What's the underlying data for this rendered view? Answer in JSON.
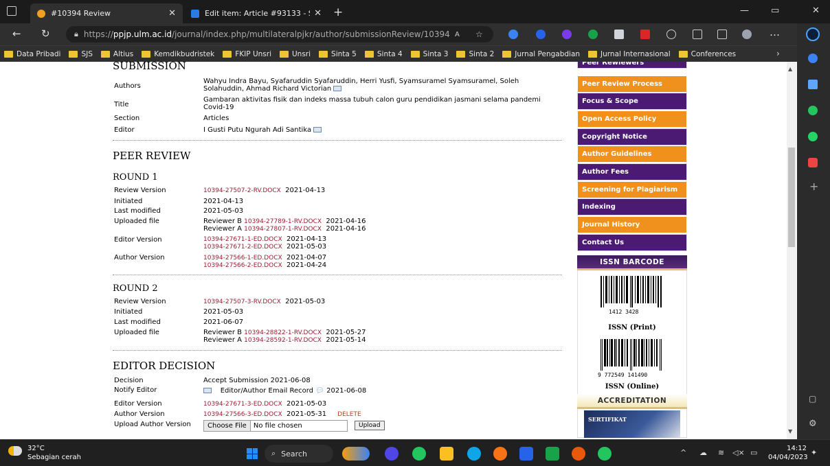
{
  "browser": {
    "tabs": [
      {
        "title": "#10394 Review",
        "active": true
      },
      {
        "title": "Edit item: Article #93133 - Sriwija",
        "active": false
      }
    ],
    "url": {
      "prefix": "https://",
      "host": "ppjp.ulm.ac.id",
      "path": "/journal/index.php/multilateralpjkr/author/submissionReview/10394"
    },
    "bookmarks": [
      "Data Pribadi",
      "SJS",
      "Altius",
      "Kemdikbudristek",
      "FKIP Unsri",
      "Unsri",
      "Sinta 5",
      "Sinta 4",
      "Sinta 3",
      "Sinta 2",
      "Jurnal Pengabdian",
      "Jurnal Internasional",
      "Conferences"
    ]
  },
  "submission": {
    "heading": "SUBMISSION",
    "authors_label": "Authors",
    "authors": "Wahyu Indra Bayu, Syafaruddin Syafaruddin, Herri Yusfi, Syamsuramel Syamsuramel, Soleh Solahuddin, Ahmad Richard Victorian",
    "title_label": "Title",
    "title": "Gambaran aktivitas fisik dan indeks massa tubuh calon guru pendidikan jasmani selama pandemi Covid-19",
    "section_label": "Section",
    "section": "Articles",
    "editor_label": "Editor",
    "editor": "I Gusti Putu Ngurah Adi Santika"
  },
  "peer_review": {
    "heading": "PEER REVIEW",
    "round1": {
      "heading": "ROUND 1",
      "review_version_label": "Review Version",
      "review_version_file": "10394-27507-2-RV.DOCX",
      "review_version_date": "2021-04-13",
      "initiated_label": "Initiated",
      "initiated": "2021-04-13",
      "last_modified_label": "Last modified",
      "last_modified": "2021-05-03",
      "uploaded_label": "Uploaded file",
      "uploaded": [
        {
          "reviewer": "Reviewer B",
          "file": "10394-27789-1-RV.DOCX",
          "date": "2021-04-16"
        },
        {
          "reviewer": "Reviewer A",
          "file": "10394-27807-1-RV.DOCX",
          "date": "2021-04-16"
        }
      ],
      "editor_version_label": "Editor Version",
      "editor_versions": [
        {
          "file": "10394-27671-1-ED.DOCX",
          "date": "2021-04-13"
        },
        {
          "file": "10394-27671-2-ED.DOCX",
          "date": "2021-05-03"
        }
      ],
      "author_version_label": "Author Version",
      "author_versions": [
        {
          "file": "10394-27566-1-ED.DOCX",
          "date": "2021-04-07"
        },
        {
          "file": "10394-27566-2-ED.DOCX",
          "date": "2021-04-24"
        }
      ]
    },
    "round2": {
      "heading": "ROUND 2",
      "review_version_label": "Review Version",
      "review_version_file": "10394-27507-3-RV.DOCX",
      "review_version_date": "2021-05-03",
      "initiated_label": "Initiated",
      "initiated": "2021-05-03",
      "last_modified_label": "Last modified",
      "last_modified": "2021-06-07",
      "uploaded_label": "Uploaded file",
      "uploaded": [
        {
          "reviewer": "Reviewer B",
          "file": "10394-28822-1-RV.DOCX",
          "date": "2021-05-27"
        },
        {
          "reviewer": "Reviewer A",
          "file": "10394-28592-1-RV.DOCX",
          "date": "2021-05-14"
        }
      ]
    }
  },
  "editor_decision": {
    "heading": "EDITOR DECISION",
    "decision_label": "Decision",
    "decision": "Accept Submission 2021-06-08",
    "notify_label": "Notify Editor",
    "notify_text": "Editor/Author Email Record",
    "notify_date": "2021-06-08",
    "editor_version_label": "Editor Version",
    "editor_version_file": "10394-27671-3-ED.DOCX",
    "editor_version_date": "2021-05-03",
    "author_version_label": "Author Version",
    "author_version_file": "10394-27566-3-ED.DOCX",
    "author_version_date": "2021-05-31",
    "delete_label": "DELETE",
    "upload_label": "Upload Author Version",
    "choose_file": "Choose File",
    "no_file": "No file chosen",
    "upload_button": "Upload"
  },
  "sidebar": {
    "menu": [
      "Peer Rewiewers",
      "Peer Review Process",
      "Focus & Scope",
      "Open Access Policy",
      "Copyright Notice",
      "Author Guidelines",
      "Author Fees",
      "Screening for Plagiarism",
      "Indexing",
      "Journal History",
      "Contact Us"
    ],
    "issn_heading": "ISSN BARCODE",
    "barcode_print_num": "1412  3428",
    "issn_print": "ISSN (Print)",
    "barcode_online_num": "9 772549 141490",
    "issn_online": "ISSN (Online)",
    "accreditation_heading": "ACCREDITATION",
    "cert_text": "SERTIFIKAT"
  },
  "taskbar": {
    "temp": "32°C",
    "weather": "Sebagian cerah",
    "search": "Search",
    "time": "14:12",
    "date": "04/04/2023"
  },
  "colors": {
    "sidebar_purple": "#4b1a73",
    "sidebar_orange": "#f0901d",
    "link": "#9b1c31"
  }
}
